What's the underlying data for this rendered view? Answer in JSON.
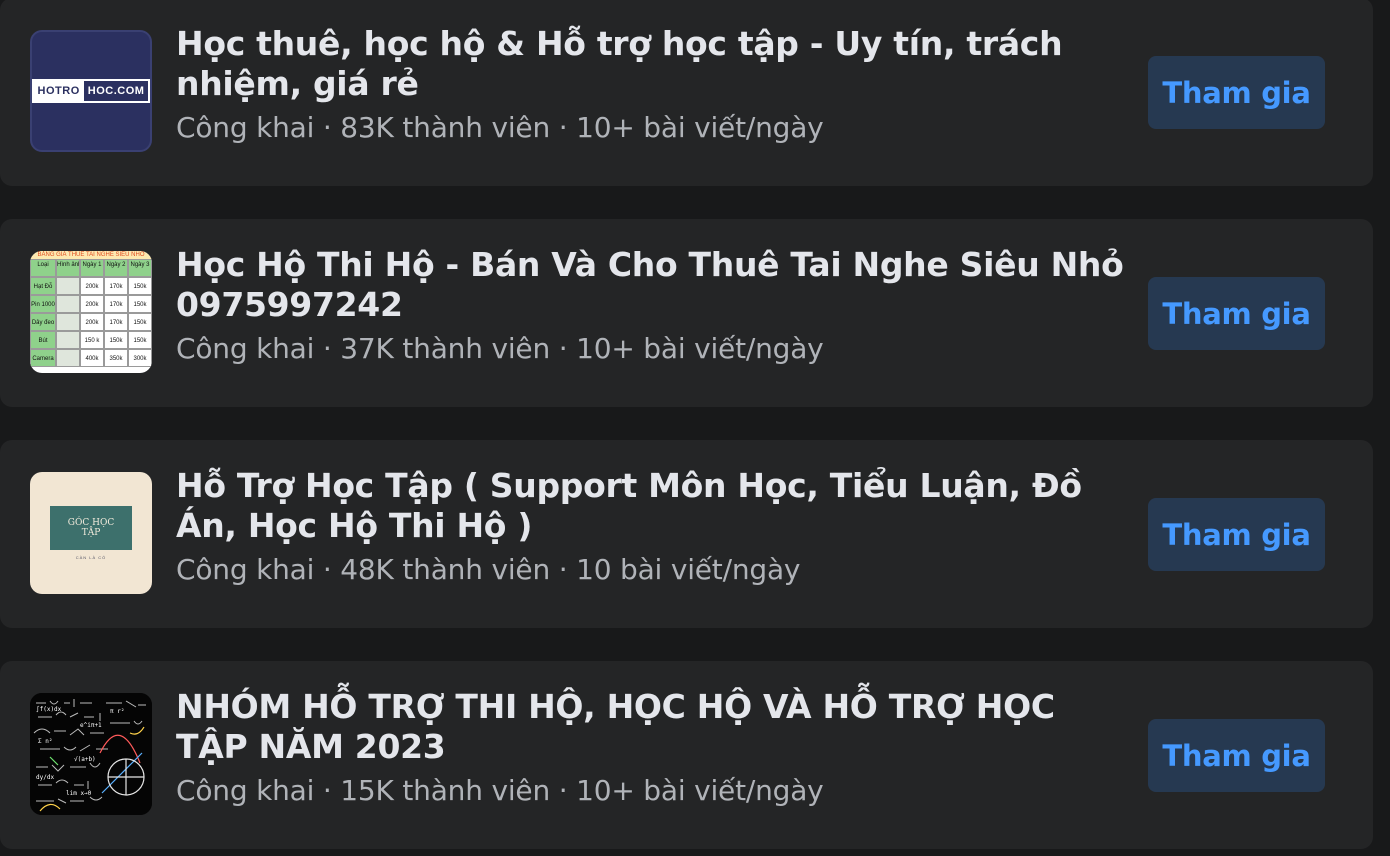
{
  "groups": [
    {
      "title": "Học thuê, học hộ & Hỗ trợ học tập - Uy tín, trách nhiệm, giá rẻ",
      "meta": "Công khai · 83K thành viên · 10+ bài viết/ngày",
      "join_label": "Tham gia",
      "thumb": {
        "logo_left": "HOTRO",
        "logo_right": "HOC.COM"
      }
    },
    {
      "title": "Học Hộ Thi Hộ - Bán Và Cho Thuê Tai Nghe Siêu Nhỏ 0975997242",
      "meta": "Công khai · 37K thành viên · 10+ bài viết/ngày",
      "join_label": "Tham gia",
      "thumb": {
        "header": "BẢNG GIÁ THUÊ TAI NGHE SIÊU NHỎ",
        "columns": [
          "Loại",
          "Hình ảnh",
          "Ngày 1",
          "Ngày 2",
          "Ngày 3"
        ],
        "rows": [
          [
            "Hạt Đỗ",
            "",
            "200k",
            "170k",
            "150k"
          ],
          [
            "Pin 1000",
            "",
            "200k",
            "170k",
            "150k"
          ],
          [
            "Dây đeo",
            "",
            "200k",
            "170k",
            "150k"
          ],
          [
            "Bút",
            "",
            "150 k",
            "150k",
            "150k"
          ],
          [
            "Camera",
            "",
            "400k",
            "350k",
            "300k"
          ]
        ]
      }
    },
    {
      "title": "Hỗ Trợ Học Tập ( Support Môn Học, Tiểu Luận, Đồ Án, Học Hộ Thi Hộ )",
      "meta": "Công khai · 48K thành viên · 10 bài viết/ngày",
      "join_label": "Tham gia",
      "thumb": {
        "line1": "GÓC HỌC",
        "line2": "TẬP",
        "sub": "CÀN LÀ CÓ"
      }
    },
    {
      "title": "NHÓM HỖ TRỢ THI HỘ, HỌC HỘ VÀ HỖ TRỢ HỌC TẬP NĂM 2023",
      "meta": "Công khai · 15K thành viên · 10+ bài viết/ngày",
      "join_label": "Tham gia",
      "thumb": {}
    }
  ],
  "colors": {
    "page_bg": "#18191a",
    "card_bg": "#242526",
    "title": "#e4e6eb",
    "meta": "#b0b3b8",
    "button_bg": "#263951",
    "button_text": "#4599ff"
  }
}
